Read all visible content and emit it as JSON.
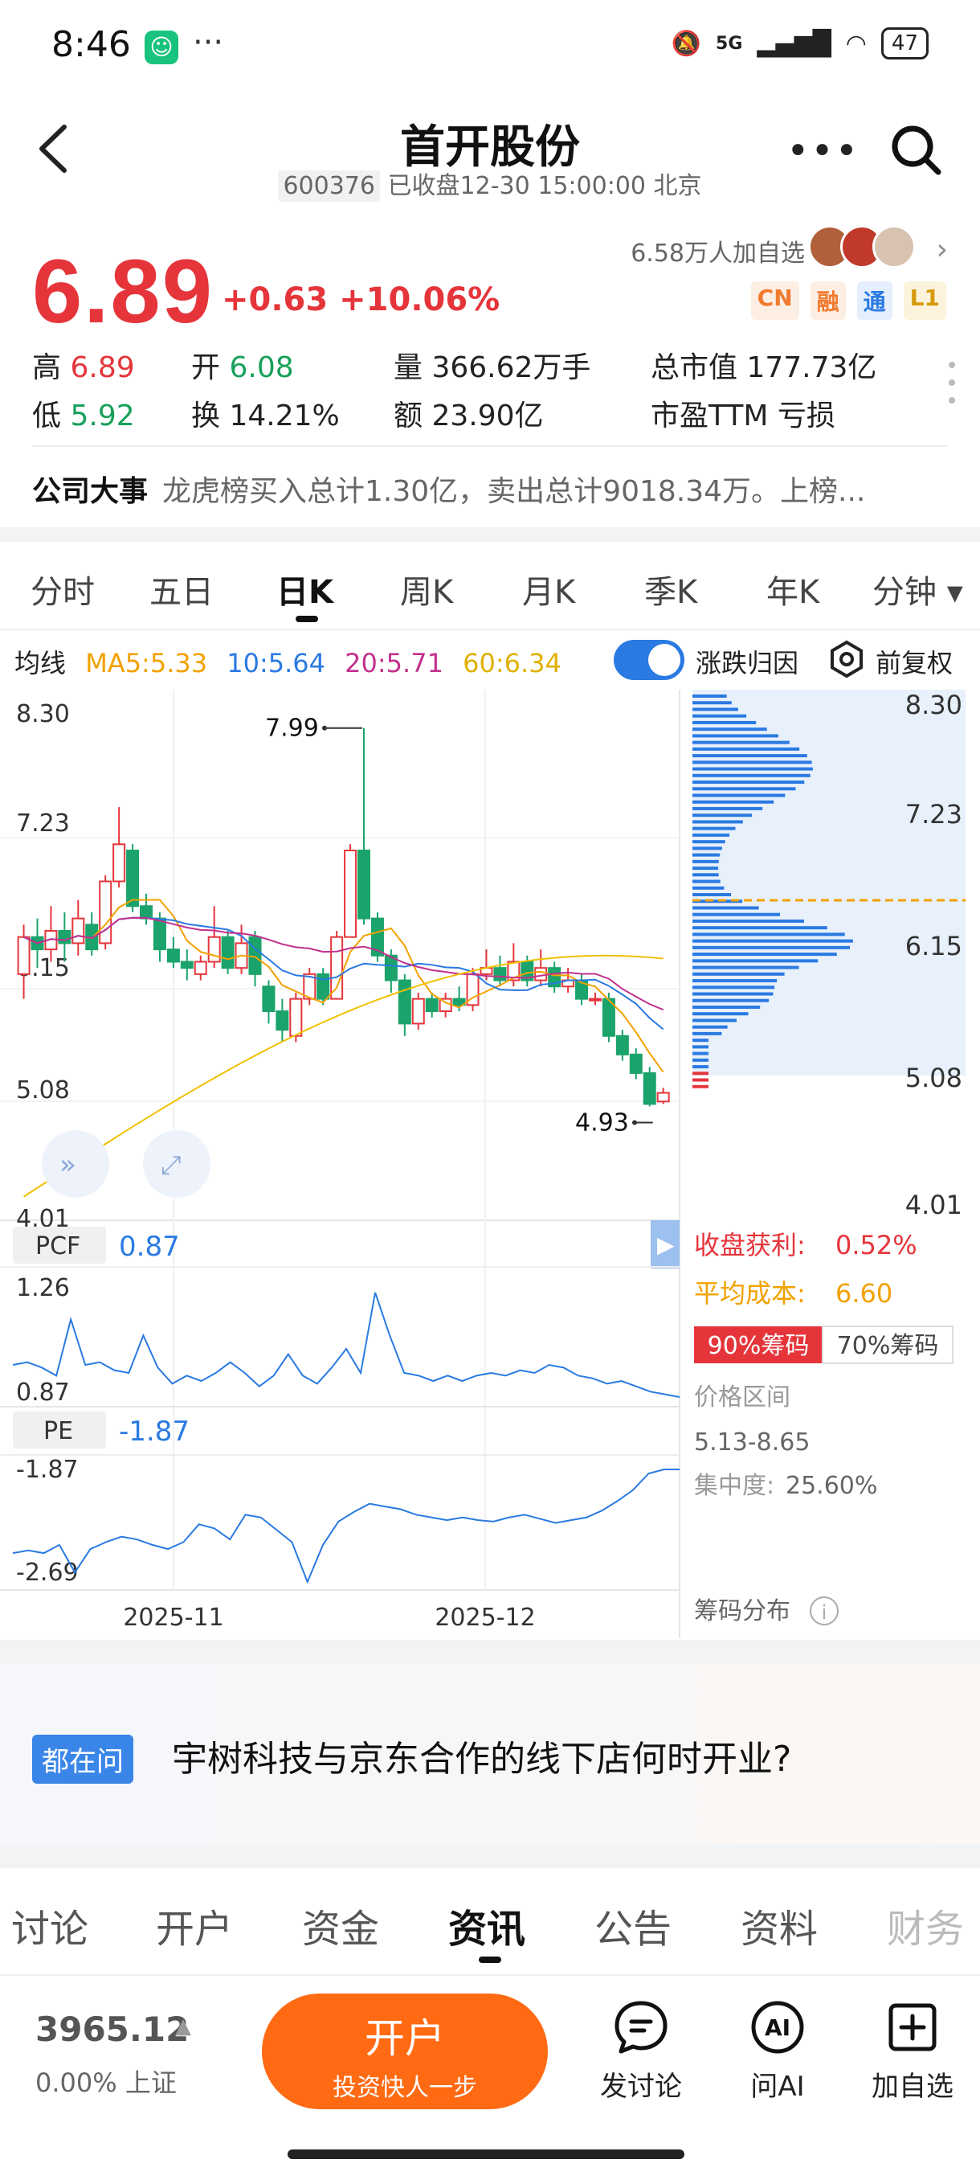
{
  "status_bar": {
    "time": "8:46",
    "dots": "···",
    "network": "5G",
    "battery": "47"
  },
  "header": {
    "title": "首开股份",
    "code": "600376",
    "status": "已收盘12-30 15:00:00 北京"
  },
  "quote": {
    "price": "6.89",
    "change": "+0.63 +10.06%",
    "watchers": "6.58万人加自选",
    "badges": [
      {
        "label": "CN",
        "color": "#f07a2f",
        "bg": "#fdeee3"
      },
      {
        "label": "融",
        "color": "#f07a2f",
        "bg": "#fdeee3"
      },
      {
        "label": "通",
        "color": "#2a7ae2",
        "bg": "#e5eefc"
      },
      {
        "label": "L1",
        "color": "#d79a0c",
        "bg": "#fcf3dc"
      }
    ],
    "stats": {
      "high_label": "高",
      "high": "6.89",
      "open_label": "开",
      "open": "6.08",
      "vol_label": "量",
      "vol": "366.62万手",
      "mcap_label": "总市值",
      "mcap": "177.73亿",
      "low_label": "低",
      "low": "5.92",
      "turn_label": "换",
      "turn": "14.21%",
      "amt_label": "额",
      "amt": "23.90亿",
      "pe_label": "市盈TTM",
      "pe": "亏损"
    }
  },
  "event": {
    "label": "公司大事",
    "text": "龙虎榜买入总计1.30亿，卖出总计9018.34万。上榜..."
  },
  "period_tabs": [
    "分时",
    "五日",
    "日K",
    "周K",
    "月K",
    "季K",
    "年K",
    "分钟"
  ],
  "ma": {
    "label": "均线",
    "ma5": "MA5:5.33",
    "ma10": "10:5.64",
    "ma20": "20:5.71",
    "ma60": "60:6.34",
    "colors": {
      "ma5": "#f2a100",
      "ma10": "#2a7ae2",
      "ma20": "#c2318e",
      "ma60": "#f0c000"
    },
    "toggle_label": "涨跌归因",
    "adjust_label": "前复权"
  },
  "chart_data": {
    "type": "candlestick",
    "price_axis": [
      "8.30",
      "7.23",
      "6.15",
      "5.08",
      "4.01"
    ],
    "ylim": [
      4.01,
      8.3
    ],
    "x_labels": [
      "2025-11",
      "2025-12"
    ],
    "high_marker": "7.99",
    "low_marker": "4.93",
    "candles": [
      [
        6.0,
        6.3,
        5.8,
        6.4
      ],
      [
        6.3,
        6.2,
        6.05,
        6.45
      ],
      [
        6.2,
        6.35,
        6.1,
        6.55
      ],
      [
        6.35,
        6.25,
        6.1,
        6.5
      ],
      [
        6.25,
        6.45,
        6.15,
        6.6
      ],
      [
        6.4,
        6.2,
        6.15,
        6.5
      ],
      [
        6.25,
        6.75,
        6.2,
        6.8
      ],
      [
        6.75,
        7.05,
        6.7,
        7.35
      ],
      [
        7.0,
        6.55,
        6.5,
        7.05
      ],
      [
        6.55,
        6.45,
        6.4,
        6.65
      ],
      [
        6.45,
        6.2,
        6.1,
        6.5
      ],
      [
        6.2,
        6.1,
        6.05,
        6.3
      ],
      [
        6.1,
        6.05,
        5.95,
        6.2
      ],
      [
        6.0,
        6.1,
        5.95,
        6.15
      ],
      [
        6.1,
        6.3,
        6.05,
        6.55
      ],
      [
        6.3,
        6.05,
        6.0,
        6.35
      ],
      [
        6.05,
        6.25,
        6.0,
        6.4
      ],
      [
        6.3,
        6.0,
        5.9,
        6.35
      ],
      [
        5.9,
        5.7,
        5.6,
        5.95
      ],
      [
        5.7,
        5.55,
        5.45,
        5.8
      ],
      [
        5.5,
        5.8,
        5.45,
        5.85
      ],
      [
        5.8,
        6.0,
        5.75,
        6.05
      ],
      [
        6.0,
        5.8,
        5.75,
        6.05
      ],
      [
        5.8,
        6.3,
        5.8,
        6.35
      ],
      [
        6.3,
        7.0,
        6.3,
        7.05
      ],
      [
        7.0,
        6.45,
        6.4,
        7.99
      ],
      [
        6.45,
        6.15,
        6.1,
        6.5
      ],
      [
        6.15,
        5.95,
        5.85,
        6.2
      ],
      [
        5.95,
        5.6,
        5.5,
        6.0
      ],
      [
        5.6,
        5.8,
        5.55,
        5.85
      ],
      [
        5.8,
        5.7,
        5.65,
        5.85
      ],
      [
        5.7,
        5.8,
        5.65,
        5.85
      ],
      [
        5.8,
        5.75,
        5.7,
        5.9
      ],
      [
        5.75,
        6.0,
        5.7,
        6.05
      ],
      [
        6.0,
        6.05,
        5.95,
        6.2
      ],
      [
        6.05,
        5.95,
        5.9,
        6.15
      ],
      [
        5.95,
        6.1,
        5.9,
        6.25
      ],
      [
        6.1,
        5.95,
        5.9,
        6.15
      ],
      [
        5.95,
        6.05,
        5.9,
        6.2
      ],
      [
        6.05,
        5.9,
        5.85,
        6.1
      ],
      [
        5.9,
        5.95,
        5.85,
        6.05
      ],
      [
        5.95,
        5.8,
        5.75,
        6.0
      ],
      [
        5.8,
        5.8,
        5.75,
        5.85
      ],
      [
        5.8,
        5.5,
        5.45,
        5.85
      ],
      [
        5.5,
        5.35,
        5.3,
        5.55
      ],
      [
        5.35,
        5.2,
        5.15,
        5.4
      ],
      [
        5.2,
        4.95,
        4.93,
        5.25
      ],
      [
        4.97,
        5.04,
        4.95,
        5.08
      ]
    ],
    "chip_panel": {
      "price_axis": [
        "8.30",
        "7.23",
        "6.15",
        "5.08",
        "4.01"
      ],
      "avg_cost_line": 6.6
    }
  },
  "sub_indicators": {
    "pcf_label": "PCF",
    "pcf_value": "0.87",
    "pcf_max": "1.26",
    "pcf_min": "0.87",
    "pe_label": "PE",
    "pe_value": "-1.87",
    "pe_max": "-1.87",
    "pe_min": "-2.69"
  },
  "chip_info": {
    "profit_label": "收盘获利:",
    "profit_value": "0.52%",
    "cost_label": "平均成本:",
    "cost_value": "6.60",
    "tab90": "90%筹码",
    "tab70": "70%筹码",
    "range_label": "价格区间",
    "range_value": "5.13-8.65",
    "concentration_label": "集中度:",
    "concentration_value": "25.60%",
    "dist_label": "筹码分布"
  },
  "ask": {
    "tag": "都在问",
    "text": "宇树科技与京东合作的线下店何时开业?"
  },
  "bottom_tabs": [
    "讨论",
    "开户",
    "资金",
    "资讯",
    "公告",
    "资料",
    "财务"
  ],
  "bottom_bar": {
    "index_value": "3965.12",
    "index_arrow": "▲",
    "index_sub": "0.00% 上证",
    "open_title": "开户",
    "open_sub": "投资快人一步",
    "discuss": "发讨论",
    "ask_ai": "问AI",
    "add_watch": "加自选",
    "ai_icon_text": "AI"
  }
}
